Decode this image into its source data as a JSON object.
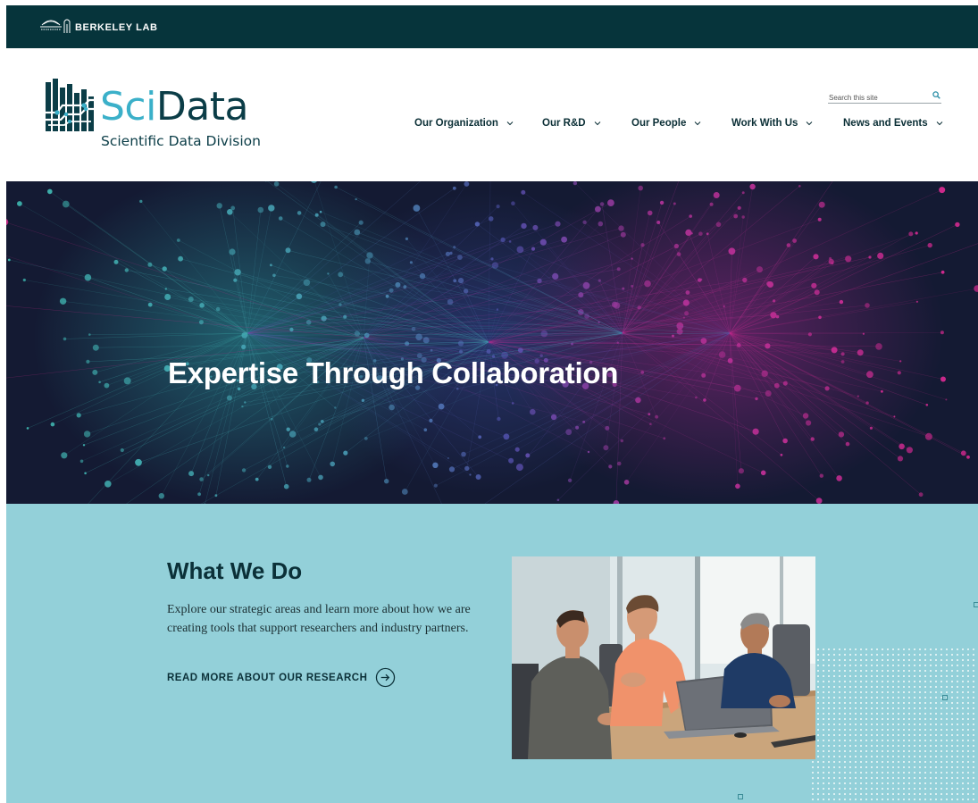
{
  "topbar": {
    "lab_name": "BERKELEY LAB"
  },
  "brand": {
    "word_sci": "Sci",
    "word_data": "Data",
    "subtitle": "Scientific Data Division",
    "colors": {
      "sci": "#3bb0c9",
      "data": "#0b3d47",
      "topbar": "#06343b"
    }
  },
  "search": {
    "placeholder": "Search this site",
    "value": "",
    "icon": "search-icon"
  },
  "nav": {
    "items": [
      {
        "label": "Our Organization",
        "icon": "chevron-down-icon"
      },
      {
        "label": "Our R&D",
        "icon": "chevron-down-icon"
      },
      {
        "label": "Our People",
        "icon": "chevron-down-icon"
      },
      {
        "label": "Work With Us",
        "icon": "chevron-down-icon"
      },
      {
        "label": "News and Events",
        "icon": "chevron-down-icon"
      }
    ]
  },
  "hero": {
    "title": "Expertise Through Collaboration"
  },
  "what_we_do": {
    "title": "What We Do",
    "description": "Explore our strategic areas and learn more about how we are creating tools that support researchers and industry partners.",
    "link_label": "READ MORE ABOUT OUR RESEARCH",
    "link_icon": "arrow-right-circle-icon",
    "background": "#93d0d9"
  }
}
